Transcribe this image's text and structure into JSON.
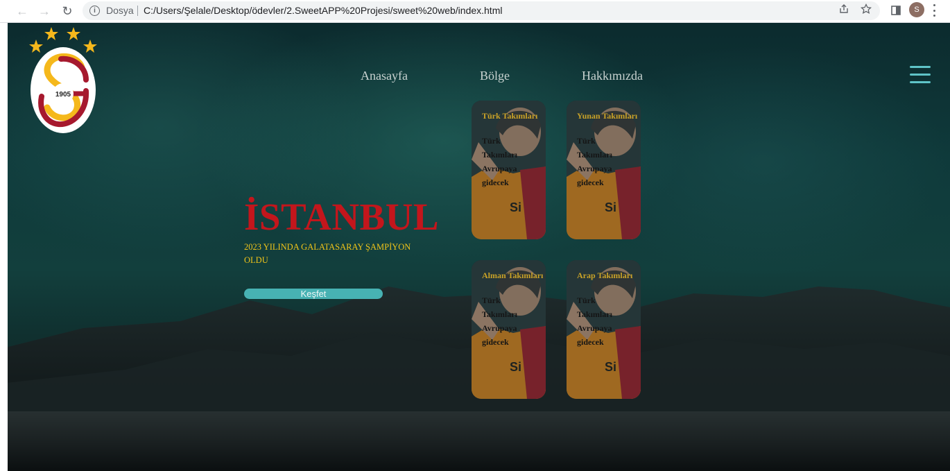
{
  "browser": {
    "scheme_label": "Dosya",
    "url": "C:/Users/Şelale/Desktop/ödevler/2.SweetAPP%20Projesi/sweet%20web/index.html",
    "profile_initial": "S"
  },
  "logo": {
    "year": "1905"
  },
  "nav": {
    "items": [
      {
        "label": "Anasayfa"
      },
      {
        "label": "Bölge"
      },
      {
        "label": "Hakkımızda"
      }
    ]
  },
  "hero": {
    "title": "İSTANBUL",
    "subtitle": "2023 YILINDA GALATASARAY ŞAMPİYON OLDU",
    "cta_label": "Keşfet"
  },
  "cards": [
    {
      "title": "Türk Takımları",
      "text": "Türk Takımları Avrupaya gidecek"
    },
    {
      "title": "Yunan Takımları",
      "text": "Türk Takımları Avrupaya gidecek"
    },
    {
      "title": "Alman Takımları",
      "text": "Türk Takımları Avrupaya gidecek"
    },
    {
      "title": "Arap Takımları",
      "text": "Türk Takımları Avrupaya gidecek"
    }
  ],
  "colors": {
    "hero_title": "#c3161c",
    "hero_subtitle": "#f0c419",
    "accent": "#47b2b3",
    "card_title": "#c9a227"
  }
}
